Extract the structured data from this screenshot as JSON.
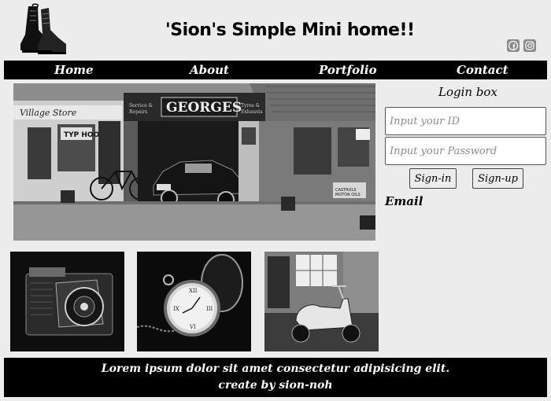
{
  "header": {
    "title": "'Sion's Simple Mini home!!",
    "logo_icon": "boots-logo-icon",
    "social_icons": [
      "facebook-icon",
      "instagram-icon"
    ]
  },
  "nav": {
    "items": [
      {
        "label": "Home"
      },
      {
        "label": "About"
      },
      {
        "label": "Portfolio"
      },
      {
        "label": "Contact"
      }
    ]
  },
  "hero": {
    "image": "vintage-shop-storefront-photo"
  },
  "login": {
    "title": "Login box",
    "id_placeholder": "Input your ID",
    "password_placeholder": "Input your Password",
    "signin_label": "Sign-in",
    "signup_label": "Sign-up",
    "email_label": "Email"
  },
  "gallery": {
    "images": [
      "camera-photo",
      "pocket-watch-photo",
      "scooter-photo"
    ]
  },
  "footer": {
    "line1": "Lorem ipsum dolor sit amet consectetur adipisicing elit.",
    "line2": "create by sion-noh"
  },
  "colors": {
    "background": "#ececec",
    "nav_bg": "#000000",
    "text": "#000000"
  }
}
